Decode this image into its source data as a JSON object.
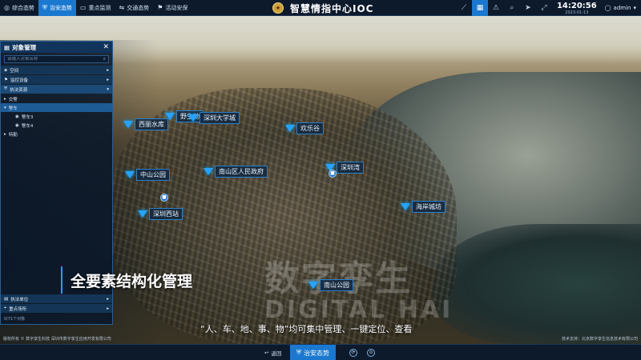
{
  "topnav": {
    "tabs": [
      {
        "label": "综合态势",
        "icon": "globe-icon",
        "active": false
      },
      {
        "label": "治安态势",
        "icon": "shield-icon",
        "active": true
      },
      {
        "label": "重点监测",
        "icon": "monitor-icon",
        "active": false
      },
      {
        "label": "交通态势",
        "icon": "traffic-icon",
        "active": false
      },
      {
        "label": "活动安保",
        "icon": "flag-icon",
        "active": false
      }
    ],
    "title": "智慧情指中心IOC",
    "time": "14:20:56",
    "date": "2023-01-13",
    "user": "admin"
  },
  "panel": {
    "title": "对象管理",
    "search_placeholder": "请输入对象名称",
    "categories": [
      {
        "label": "空间",
        "open": false
      },
      {
        "label": "监控设备",
        "open": false
      },
      {
        "label": "执法资源",
        "open": true
      }
    ],
    "tree": {
      "n1": "交警",
      "n2": "警车",
      "n3": "警车3",
      "n4": "警车4",
      "n5": "特勤"
    },
    "bottom_categories": [
      {
        "label": "执法单位"
      },
      {
        "label": "重点场所"
      }
    ],
    "footer": "0/71个对象"
  },
  "map": {
    "markers": {
      "m1": "西丽水库",
      "m2": "野生动",
      "m3": "深圳大学城",
      "m4": "欢乐谷",
      "m5": "中山公园",
      "m6": "南山区人民政府",
      "m7": "深圳湾",
      "m8": "深圳西站",
      "m9": "海岸城坊",
      "m10": "南山公园"
    },
    "watermark_cn": "数字孪生",
    "watermark_en": "DIGITAL HAI"
  },
  "captions": {
    "main": "全要素结构化管理",
    "sub": "“人、车、地、事、物”均可集中管理、一键定位、查看"
  },
  "copyright": {
    "left": "版权所有 © 数字孪生科技 深圳市数字孪生应用开发有限公司",
    "right": "技术支持：北京数字孪生信息技术有限公司"
  },
  "bottombar": {
    "back": "返回",
    "active": "治安态势"
  },
  "colors": {
    "accent": "#1a78d0",
    "marker": "#27a3ff",
    "panel_border": "#2a5e92"
  }
}
